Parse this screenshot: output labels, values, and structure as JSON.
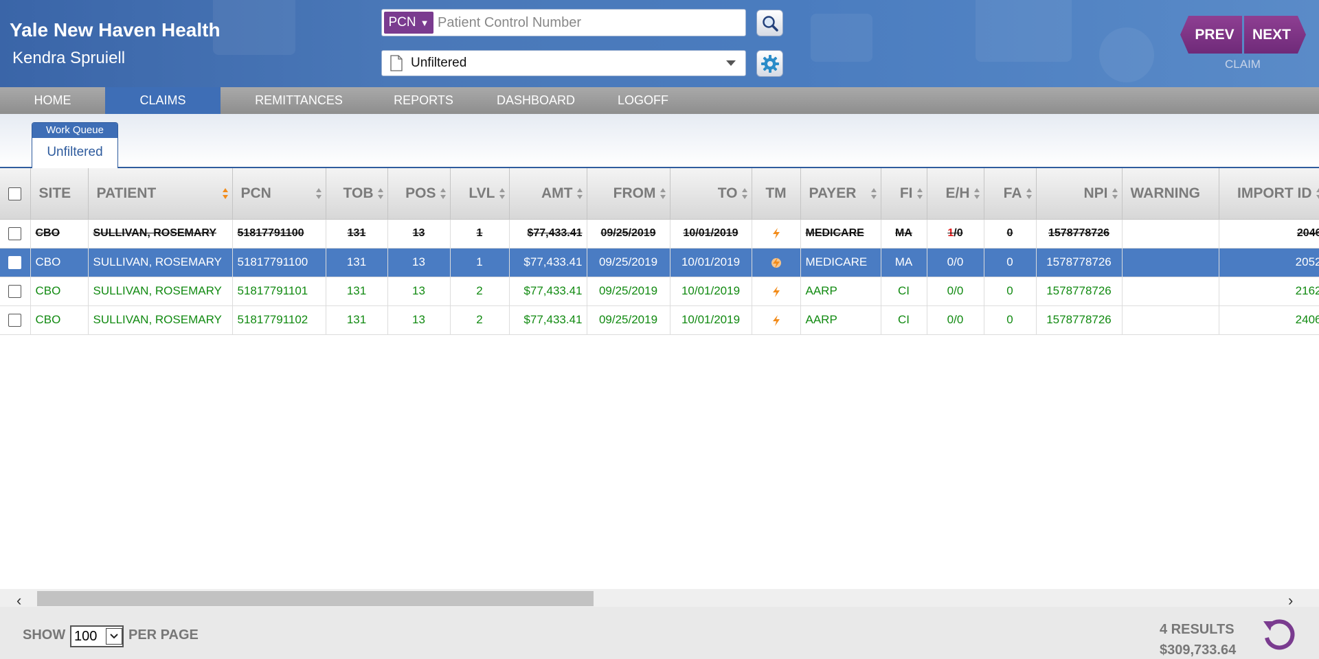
{
  "header": {
    "org_name": "Yale New Haven Health",
    "user_name": "Kendra Spruiell",
    "search": {
      "type": "PCN",
      "placeholder": "Patient Control Number",
      "value": ""
    },
    "filter": {
      "value": "Unfiltered"
    },
    "prev_label": "PREV",
    "next_label": "NEXT",
    "nav_context": "CLAIM"
  },
  "nav": {
    "items": [
      "HOME",
      "CLAIMS",
      "REMITTANCES",
      "REPORTS",
      "DASHBOARD",
      "LOGOFF"
    ],
    "active": "CLAIMS"
  },
  "tab": {
    "header": "Work Queue",
    "label": "Unfiltered"
  },
  "table": {
    "columns": [
      "SITE",
      "PATIENT",
      "PCN",
      "TOB",
      "POS",
      "LVL",
      "AMT",
      "FROM",
      "TO",
      "TM",
      "PAYER",
      "FI",
      "E/H",
      "FA",
      "NPI",
      "WARNING",
      "IMPORT ID"
    ],
    "rows": [
      {
        "state": "void",
        "site": "CBO",
        "patient": "SULLIVAN, ROSEMARY",
        "pcn": "51817791100",
        "tob": "131",
        "pos": "13",
        "lvl": "1",
        "amt": "$77,433.41",
        "from": "09/25/2019",
        "to": "10/01/2019",
        "tm": "lightning-icon",
        "payer": "MEDICARE",
        "fi": "MA",
        "eh_e": "1",
        "eh_h": "/0",
        "fa": "0",
        "npi": "1578778726",
        "warning": "",
        "import_id": "2046"
      },
      {
        "state": "selected",
        "site": "CBO",
        "patient": "SULLIVAN, ROSEMARY",
        "pcn": "51817791100",
        "tob": "131",
        "pos": "13",
        "lvl": "1",
        "amt": "$77,433.41",
        "from": "09/25/2019",
        "to": "10/01/2019",
        "tm": "lightning-icon",
        "payer": "MEDICARE",
        "fi": "MA",
        "eh_e": "0",
        "eh_h": "/0",
        "fa": "0",
        "npi": "1578778726",
        "warning": "",
        "import_id": "2052"
      },
      {
        "state": "green",
        "site": "CBO",
        "patient": "SULLIVAN, ROSEMARY",
        "pcn": "51817791101",
        "tob": "131",
        "pos": "13",
        "lvl": "2",
        "amt": "$77,433.41",
        "from": "09/25/2019",
        "to": "10/01/2019",
        "tm": "lightning-icon",
        "payer": "AARP",
        "fi": "CI",
        "eh_e": "0",
        "eh_h": "/0",
        "fa": "0",
        "npi": "1578778726",
        "warning": "",
        "import_id": "2162"
      },
      {
        "state": "green",
        "site": "CBO",
        "patient": "SULLIVAN, ROSEMARY",
        "pcn": "51817791102",
        "tob": "131",
        "pos": "13",
        "lvl": "2",
        "amt": "$77,433.41",
        "from": "09/25/2019",
        "to": "10/01/2019",
        "tm": "lightning-icon",
        "payer": "AARP",
        "fi": "CI",
        "eh_e": "0",
        "eh_h": "/0",
        "fa": "0",
        "npi": "1578778726",
        "warning": "",
        "import_id": "2406"
      }
    ]
  },
  "footer": {
    "show_label": "SHOW",
    "per_page_value": "100",
    "per_page_label": "PER PAGE",
    "results": "4 RESULTS",
    "total": "$309,733.64"
  },
  "colors": {
    "header_blue": "#4a78b8",
    "accent_purple": "#7a3b8f",
    "selected_row": "#4a7cc3",
    "green_text": "#118a11",
    "sort_active": "#f28c1b"
  }
}
